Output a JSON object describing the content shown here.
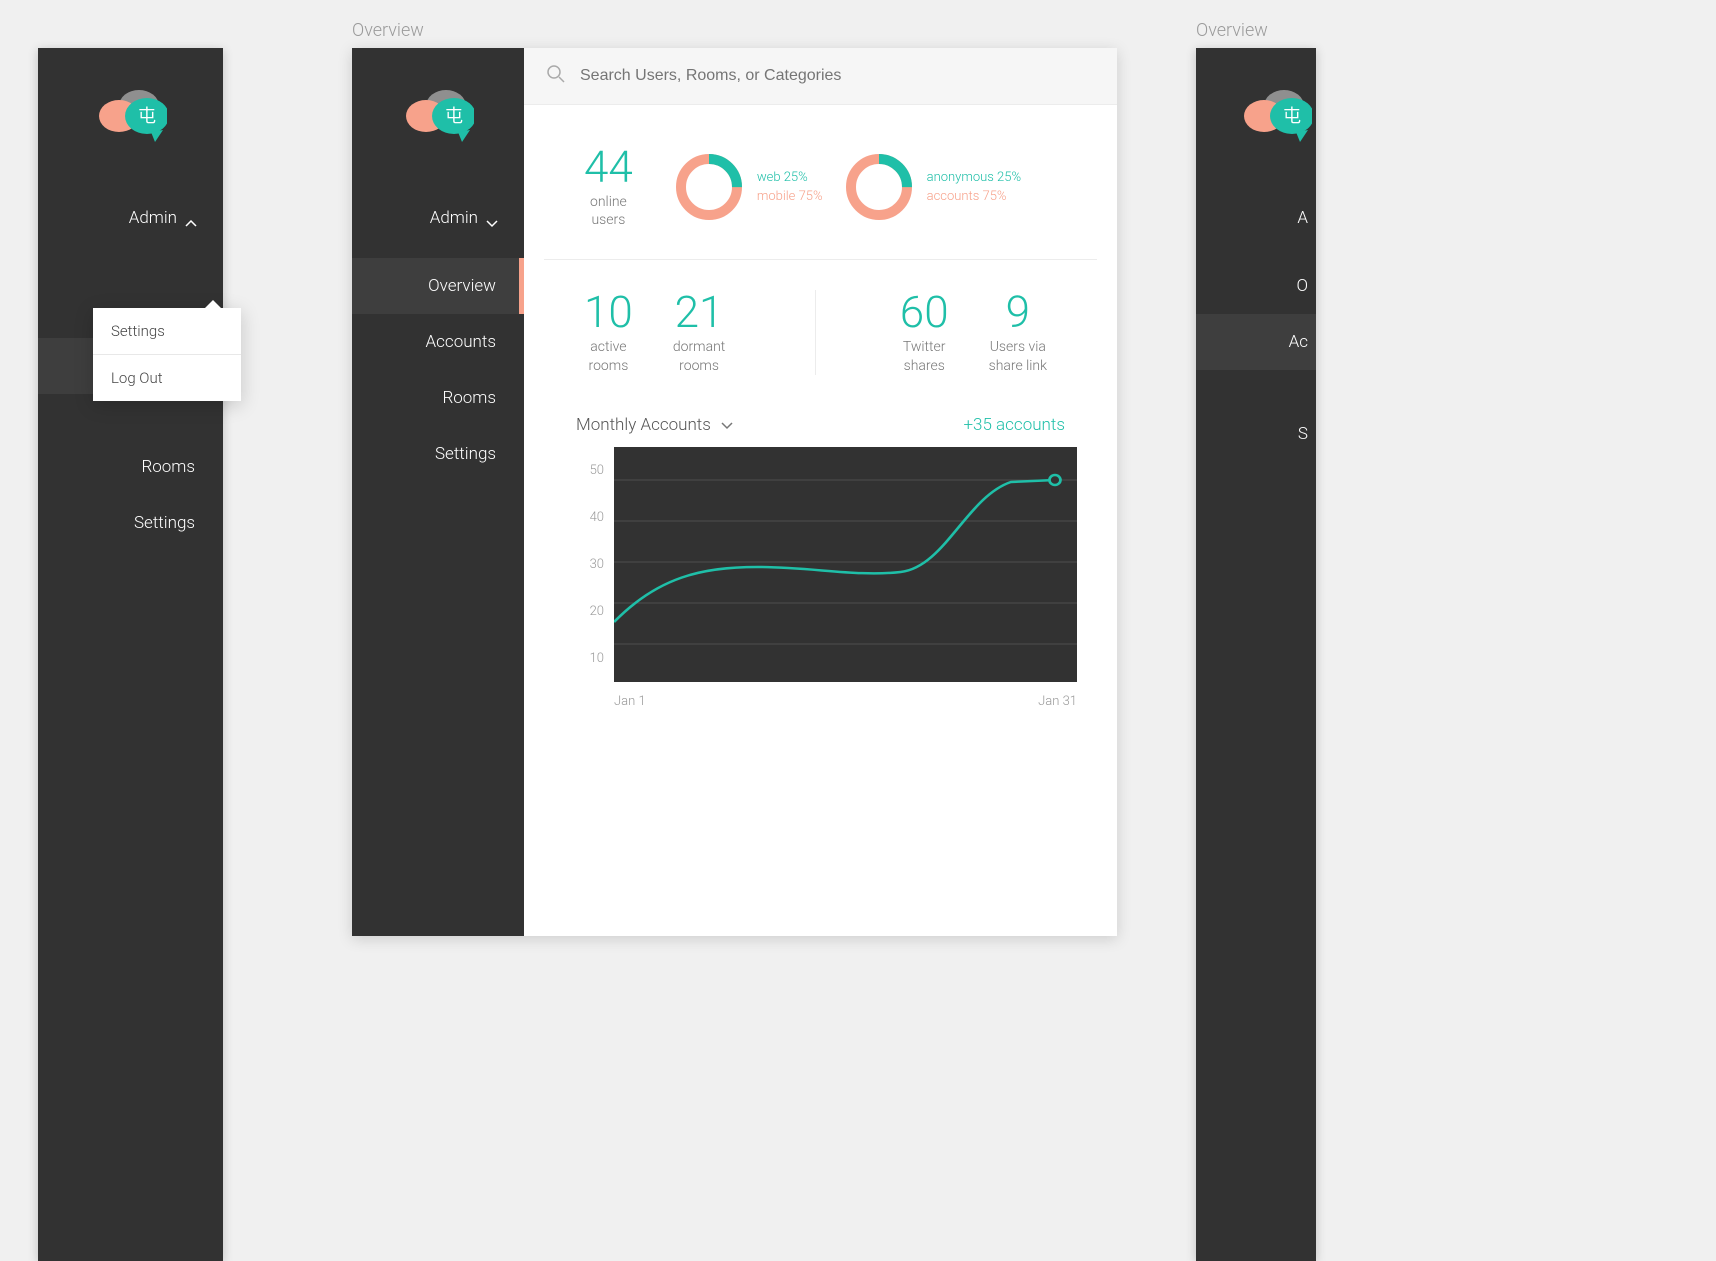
{
  "panel1": {
    "admin_label": "Admin",
    "dropdown": {
      "settings": "Settings",
      "logout": "Log Out"
    },
    "nav": {
      "rooms": "Rooms",
      "settings": "Settings"
    }
  },
  "panel2": {
    "title": "Overview",
    "admin_label": "Admin",
    "nav": {
      "overview": "Overview",
      "accounts": "Accounts",
      "rooms": "Rooms",
      "settings": "Settings"
    },
    "search_placeholder": "Search Users, Rooms, or Categories",
    "online": {
      "value": "44",
      "label1": "online",
      "label2": "users"
    },
    "donut1": {
      "l1": "web 25%",
      "l2": "mobile 75%"
    },
    "donut2": {
      "l1": "anonymous 25%",
      "l2": "accounts 75%"
    },
    "rooms_active": {
      "value": "10",
      "label1": "active",
      "label2": "rooms"
    },
    "rooms_dormant": {
      "value": "21",
      "label1": "dormant",
      "label2": "rooms"
    },
    "twitter": {
      "value": "60",
      "label1": "Twitter",
      "label2": "shares"
    },
    "sharelink": {
      "value": "9",
      "label1": "Users via",
      "label2": "share link"
    },
    "chart": {
      "dropdown": "Monthly Accounts",
      "delta": "+35 accounts",
      "x_start": "Jan 1",
      "x_end": "Jan 31",
      "y_ticks": [
        "50",
        "40",
        "30",
        "20",
        "10"
      ]
    }
  },
  "panel3": {
    "title": "Overview",
    "admin_label": "A",
    "nav": {
      "overview": "O",
      "accounts": "Ac",
      "rooms": "",
      "settings": "S"
    }
  },
  "colors": {
    "teal": "#1fbfa8",
    "coral": "#f7a28b",
    "dark": "#323232",
    "grey": "#9a9a9a"
  },
  "chart_data": {
    "type": "line",
    "title": "Monthly Accounts",
    "xlabel": "",
    "ylabel": "",
    "ylim": [
      0,
      55
    ],
    "x": [
      1,
      4,
      7,
      10,
      13,
      16,
      19,
      22,
      25,
      28,
      31
    ],
    "values": [
      15,
      22,
      27,
      28,
      28,
      27,
      26,
      28,
      38,
      49,
      50
    ],
    "x_ticks": [
      "Jan 1",
      "Jan 31"
    ],
    "y_ticks": [
      10,
      20,
      30,
      40,
      50
    ],
    "annotations": {
      "delta": "+35 accounts"
    },
    "donuts": [
      {
        "slices": [
          {
            "label": "web",
            "value": 25
          },
          {
            "label": "mobile",
            "value": 75
          }
        ]
      },
      {
        "slices": [
          {
            "label": "anonymous",
            "value": 25
          },
          {
            "label": "accounts",
            "value": 75
          }
        ]
      }
    ]
  }
}
